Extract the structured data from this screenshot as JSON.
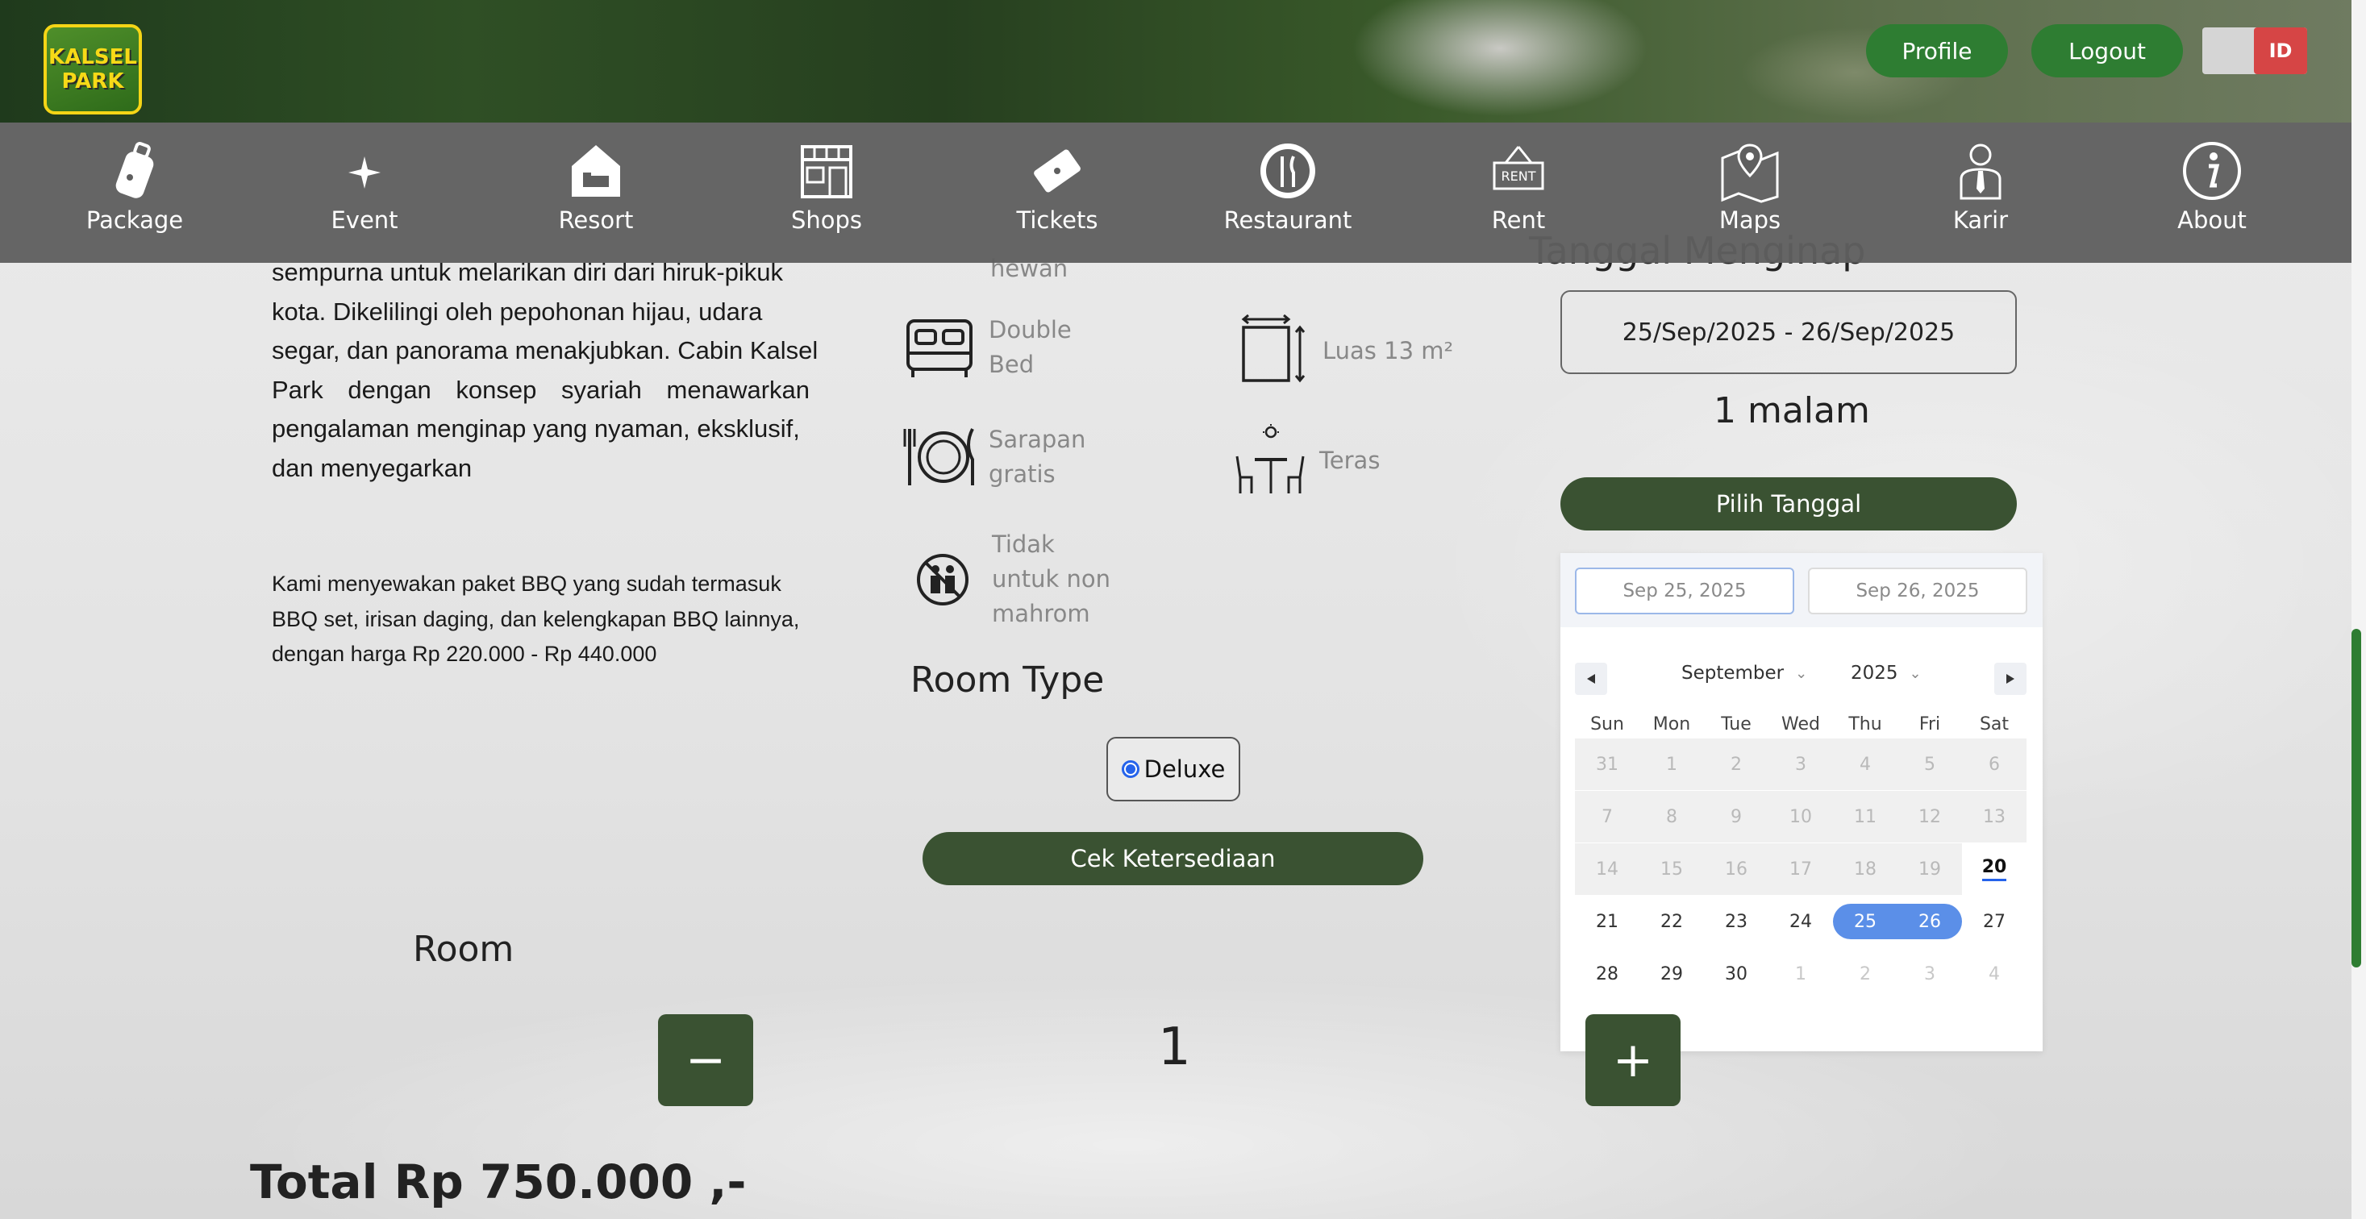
{
  "header": {
    "logo_line1": "KALSEL",
    "logo_line2": "PARK",
    "profile_label": "Profile",
    "logout_label": "Logout",
    "lang_label": "ID"
  },
  "nav": [
    {
      "label": "Package",
      "icon": "luggage-icon"
    },
    {
      "label": "Event",
      "icon": "sparkle-icon"
    },
    {
      "label": "Resort",
      "icon": "house-bed-icon"
    },
    {
      "label": "Shops",
      "icon": "storefront-icon"
    },
    {
      "label": "Tickets",
      "icon": "ticket-icon"
    },
    {
      "label": "Restaurant",
      "icon": "fork-knife-icon"
    },
    {
      "label": "Rent",
      "icon": "rent-sign-icon"
    },
    {
      "label": "Maps",
      "icon": "map-pin-icon"
    },
    {
      "label": "Karir",
      "icon": "person-tie-icon"
    },
    {
      "label": "About",
      "icon": "info-icon"
    }
  ],
  "description": {
    "para1_l1": "sempurna untuk melarikan diri dari hiruk-pikuk",
    "para1_l2": "kota. Dikelilingi oleh pepohonan hijau, udara",
    "para1_l3": "segar, dan panorama menakjubkan. Cabin Kalsel",
    "para1_l4": "Park dengan konsep syariah menawarkan",
    "para1_l5": "pengalaman menginap yang nyaman, eksklusif,",
    "para1_l6": "dan menyegarkan",
    "para2_l1": "Kami menyewakan paket BBQ yang sudah termasuk",
    "para2_l2": "BBQ set, irisan daging, dan kelengkapan BBQ lainnya,",
    "para2_l3": "dengan harga Rp 220.000 - Rp 440.000"
  },
  "amenities": {
    "partial_label": "hewan",
    "double_bed_l1": "Double",
    "double_bed_l2": "Bed",
    "area": "Luas 13 m²",
    "breakfast_l1": "Sarapan",
    "breakfast_l2": "gratis",
    "terrace": "Teras",
    "no_nonmahram_l1": "Tidak",
    "no_nonmahram_l2": "untuk non",
    "no_nonmahram_l3": "mahrom"
  },
  "room_type": {
    "title": "Room Type",
    "option": "Deluxe",
    "check_button": "Cek Ketersediaan"
  },
  "booking": {
    "title_partial": "Tanggal Menginap",
    "date_range": "25/Sep/2025 - 26/Sep/2025",
    "nights": "1 malam",
    "choose_date_button": "Pilih Tanggal"
  },
  "calendar": {
    "start_input": "Sep 25, 2025",
    "end_input": "Sep 26, 2025",
    "month": "September",
    "year": "2025",
    "weekdays": [
      "Sun",
      "Mon",
      "Tue",
      "Wed",
      "Thu",
      "Fri",
      "Sat"
    ],
    "weeks": [
      [
        "31",
        "1",
        "2",
        "3",
        "4",
        "5",
        "6"
      ],
      [
        "7",
        "8",
        "9",
        "10",
        "11",
        "12",
        "13"
      ],
      [
        "14",
        "15",
        "16",
        "17",
        "18",
        "19",
        "20"
      ],
      [
        "21",
        "22",
        "23",
        "24",
        "25",
        "26",
        "27"
      ],
      [
        "28",
        "29",
        "30",
        "1",
        "2",
        "3",
        "4"
      ]
    ]
  },
  "room": {
    "label": "Room",
    "minus": "−",
    "count": "1",
    "plus": "+"
  },
  "total": "Total Rp 750.000 ,-"
}
